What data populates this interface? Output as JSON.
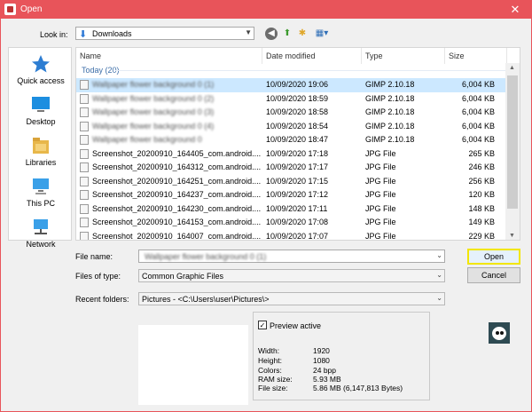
{
  "window": {
    "title": "Open",
    "close_glyph": "✕"
  },
  "toolbar": {
    "look_in_label": "Look in:",
    "look_in_value": "Downloads",
    "back_glyph": "◀",
    "up_glyph": "⬆",
    "new_folder_glyph": "✱",
    "view_glyph": "▦▾"
  },
  "sidebar": {
    "items": [
      {
        "label": "Quick access",
        "icon": "star-icon"
      },
      {
        "label": "Desktop",
        "icon": "desktop-icon"
      },
      {
        "label": "Libraries",
        "icon": "libraries-icon"
      },
      {
        "label": "This PC",
        "icon": "computer-icon"
      },
      {
        "label": "Network",
        "icon": "network-icon"
      }
    ]
  },
  "filelist": {
    "columns": [
      "Name",
      "Date modified",
      "Type",
      "Size"
    ],
    "group_label": "Today (20)",
    "rows": [
      {
        "name": "Wallpaper flower background 0 (1)",
        "date": "10/09/2020 19:06",
        "type": "GIMP 2.10.18",
        "size": "6,004 KB",
        "selected": true,
        "blurred": true
      },
      {
        "name": "Wallpaper flower background 0 (2)",
        "date": "10/09/2020 18:59",
        "type": "GIMP 2.10.18",
        "size": "6,004 KB",
        "selected": false,
        "blurred": true
      },
      {
        "name": "Wallpaper flower background 0 (3)",
        "date": "10/09/2020 18:58",
        "type": "GIMP 2.10.18",
        "size": "6,004 KB",
        "selected": false,
        "blurred": true
      },
      {
        "name": "Wallpaper flower background 0 (4)",
        "date": "10/09/2020 18:54",
        "type": "GIMP 2.10.18",
        "size": "6,004 KB",
        "selected": false,
        "blurred": true
      },
      {
        "name": "Wallpaper flower background 0",
        "date": "10/09/2020 18:47",
        "type": "GIMP 2.10.18",
        "size": "6,004 KB",
        "selected": false,
        "blurred": true
      },
      {
        "name": "Screenshot_20200910_164405_com.android....",
        "date": "10/09/2020 17:18",
        "type": "JPG File",
        "size": "265 KB",
        "selected": false,
        "blurred": false
      },
      {
        "name": "Screenshot_20200910_164312_com.android....",
        "date": "10/09/2020 17:17",
        "type": "JPG File",
        "size": "246 KB",
        "selected": false,
        "blurred": false
      },
      {
        "name": "Screenshot_20200910_164251_com.android....",
        "date": "10/09/2020 17:15",
        "type": "JPG File",
        "size": "256 KB",
        "selected": false,
        "blurred": false
      },
      {
        "name": "Screenshot_20200910_164237_com.android....",
        "date": "10/09/2020 17:12",
        "type": "JPG File",
        "size": "120 KB",
        "selected": false,
        "blurred": false
      },
      {
        "name": "Screenshot_20200910_164230_com.android....",
        "date": "10/09/2020 17:11",
        "type": "JPG File",
        "size": "148 KB",
        "selected": false,
        "blurred": false
      },
      {
        "name": "Screenshot_20200910_164153_com.android....",
        "date": "10/09/2020 17:08",
        "type": "JPG File",
        "size": "149 KB",
        "selected": false,
        "blurred": false
      },
      {
        "name": "Screenshot_20200910_164007_com.android....",
        "date": "10/09/2020 17:07",
        "type": "JPG File",
        "size": "229 KB",
        "selected": false,
        "blurred": false
      }
    ]
  },
  "form": {
    "file_name_label": "File name:",
    "file_name_value": "Wallpaper flower background 0 (1)",
    "file_type_label": "Files of type:",
    "file_type_value": "Common Graphic Files",
    "recent_label": "Recent folders:",
    "recent_value": "Pictures  -  <C:\\Users\\user\\Pictures\\>",
    "open_button": "Open",
    "cancel_button": "Cancel"
  },
  "preview": {
    "checkbox_label": "Preview active",
    "checked": true,
    "check_glyph": "✓",
    "info": [
      {
        "label": "Width:",
        "value": "1920"
      },
      {
        "label": "Height:",
        "value": "1080"
      },
      {
        "label": "Colors:",
        "value": "24 bpp"
      },
      {
        "label": "RAM size:",
        "value": "5.93 MB"
      },
      {
        "label": "File size:",
        "value": "5.86 MB (6,147,813 Bytes)"
      }
    ]
  },
  "colors": {
    "titlebar": "#e8545a",
    "selection": "#cce8ff",
    "default_button_border": "#f2e600",
    "group_text": "#3c6ea8"
  }
}
